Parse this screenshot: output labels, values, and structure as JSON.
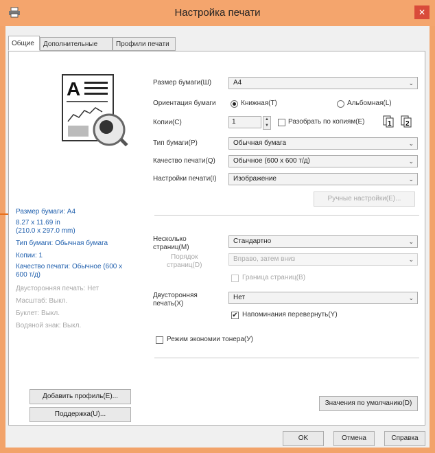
{
  "window": {
    "title": "Настройка печати",
    "close_glyph": "✕",
    "icon": "printer-icon"
  },
  "tabs": [
    "Общие",
    "Дополнительные",
    "Профили печати"
  ],
  "summary": {
    "paper_size": "Размер бумаги: A4",
    "dims_in": "8.27 x 11.69 in",
    "dims_mm": "(210.0 x 297.0 mm)",
    "paper_type": "Тип бумаги: Обычная бумага",
    "copies": "Копии: 1",
    "quality": "Качество печати: Обычное (600 x 600 т/д)",
    "duplex": "Двусторонняя печать: Нет",
    "scale": "Масштаб: Выкл.",
    "booklet": "Буклет: Выкл.",
    "watermark": "Водяной знак: Выкл."
  },
  "settings": {
    "paper_size_label": "Размер бумаги(Ш)",
    "paper_size_value": "A4",
    "orientation_label": "Ориентация бумаги",
    "portrait_label": "Книжная(Т)",
    "landscape_label": "Альбомная(L)",
    "copies_label": "Копии(С)",
    "copies_value": "1",
    "collate_label": "Разобрать по копиям(Е)",
    "paper_type_label": "Тип бумаги(Р)",
    "paper_type_value": "Обычная бумага",
    "quality_label": "Качество печати(Q)",
    "quality_value": "Обычное (600 x 600 т/д)",
    "print_settings_label": "Настройки печати(I)",
    "print_settings_value": "Изображение",
    "manual_settings_button": "Ручные настройки(Е)...",
    "multipage_label_1": "Несколько",
    "multipage_label_2": "страниц(М)",
    "multipage_value": "Стандартно",
    "page_order_label_1": "Порядок",
    "page_order_label_2": "страниц(D)",
    "page_order_value": "Вправо, затем вниз",
    "border_label": "Граница страниц(В)",
    "duplex_label_1": "Двусторонняя",
    "duplex_label_2": "печать(Х)",
    "duplex_value": "Нет",
    "flip_reminder_label": "Напоминания перевернуть(Y)",
    "toner_save_label": "Режим экономии тонера(У)"
  },
  "buttons": {
    "add_profile": "Добавить профиль(Е)...",
    "support": "Поддержка(U)...",
    "defaults": "Значения по умолчанию(D)",
    "ok": "OK",
    "cancel": "Отмена",
    "help": "Справка"
  },
  "glyphs": {
    "dropdown": "⌄",
    "check": "✔",
    "spin_up": "▲",
    "spin_down": "▼"
  },
  "colors": {
    "title_bar": "#f4a56d",
    "link_blue": "#1f5fad",
    "close": "#d94b3a"
  }
}
